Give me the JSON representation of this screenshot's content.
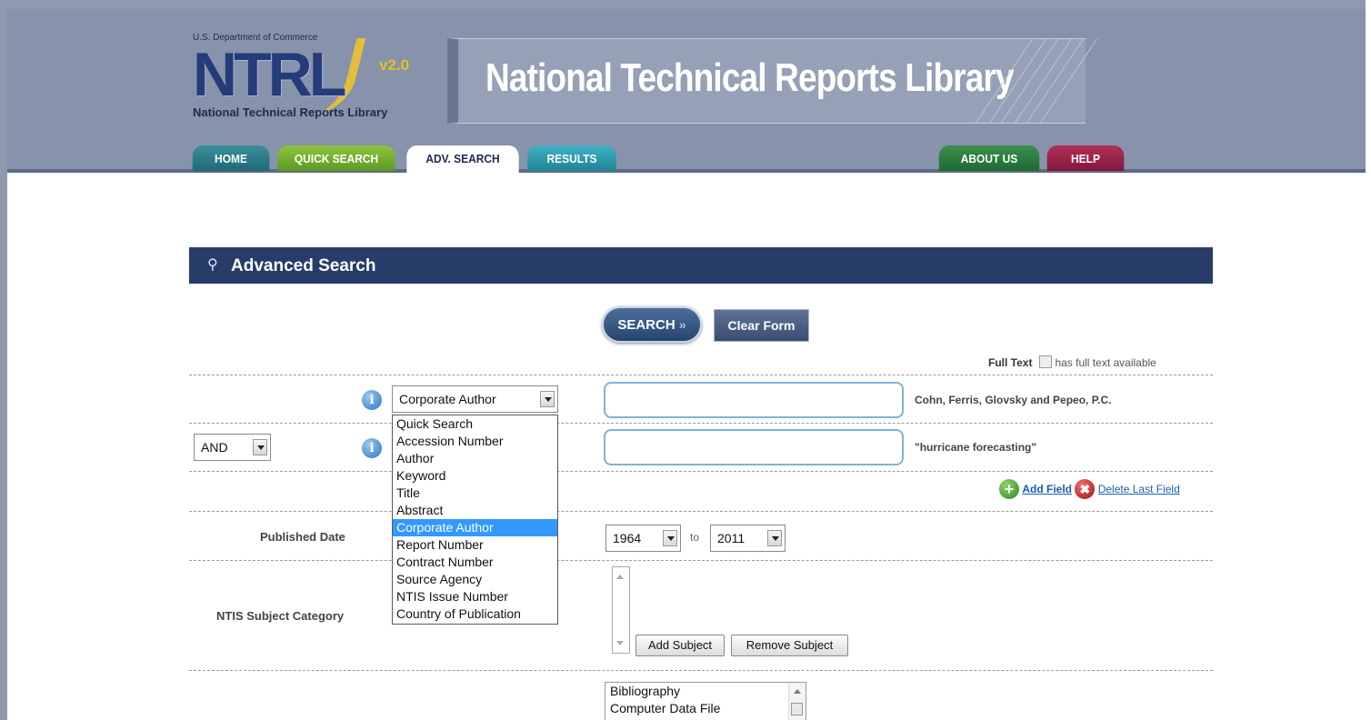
{
  "header": {
    "dept_label": "U.S. Department of Commerce",
    "logo_letters": "NTRL",
    "logo_version": "v2.0",
    "logo_subtitle": "National Technical Reports Library",
    "banner_title": "National Technical Reports Library"
  },
  "nav": {
    "home": "HOME",
    "quick_search": "QUICK SEARCH",
    "adv_search": "ADV. SEARCH",
    "results": "RESULTS",
    "about_us": "ABOUT US",
    "help": "HELP"
  },
  "section": {
    "title": "Advanced Search"
  },
  "buttons": {
    "search": "SEARCH",
    "search_chevron": "»",
    "clear_form": "Clear Form",
    "add_subject": "Add Subject",
    "remove_subject": "Remove Subject"
  },
  "fulltext": {
    "label": "Full Text",
    "hint": "has full text available"
  },
  "rows": {
    "row1": {
      "field_selected": "Corporate Author",
      "example": "Cohn, Ferris, Glovsky and Pepeo, P.C."
    },
    "row2": {
      "operator": "AND",
      "example": "\"hurricane forecasting\""
    }
  },
  "field_dropdown": {
    "options": [
      "Quick Search",
      "Accession Number",
      "Author",
      "Keyword",
      "Title",
      "Abstract",
      "Corporate Author",
      "Report Number",
      "Contract Number",
      "Source Agency",
      "NTIS Issue Number",
      "Country of Publication"
    ],
    "selected_index": 6
  },
  "field_actions": {
    "add_field": "Add Field",
    "delete_last_field": "Delete Last Field"
  },
  "published_date": {
    "label": "Published Date",
    "from": "1964",
    "to_label": "to",
    "to": "2011"
  },
  "subject_category": {
    "label": "NTIS Subject Category"
  },
  "document_types": {
    "items": [
      "Bibliography",
      "Computer Data File"
    ]
  },
  "icons": {
    "info": "info-icon",
    "magnifier": "search-icon",
    "add": "plus-circle-icon",
    "delete": "x-circle-icon"
  },
  "colors": {
    "header_bg": "#8792ab",
    "section_bar": "#283c6a",
    "selection": "#3399ff",
    "link": "#1a5fb4"
  }
}
